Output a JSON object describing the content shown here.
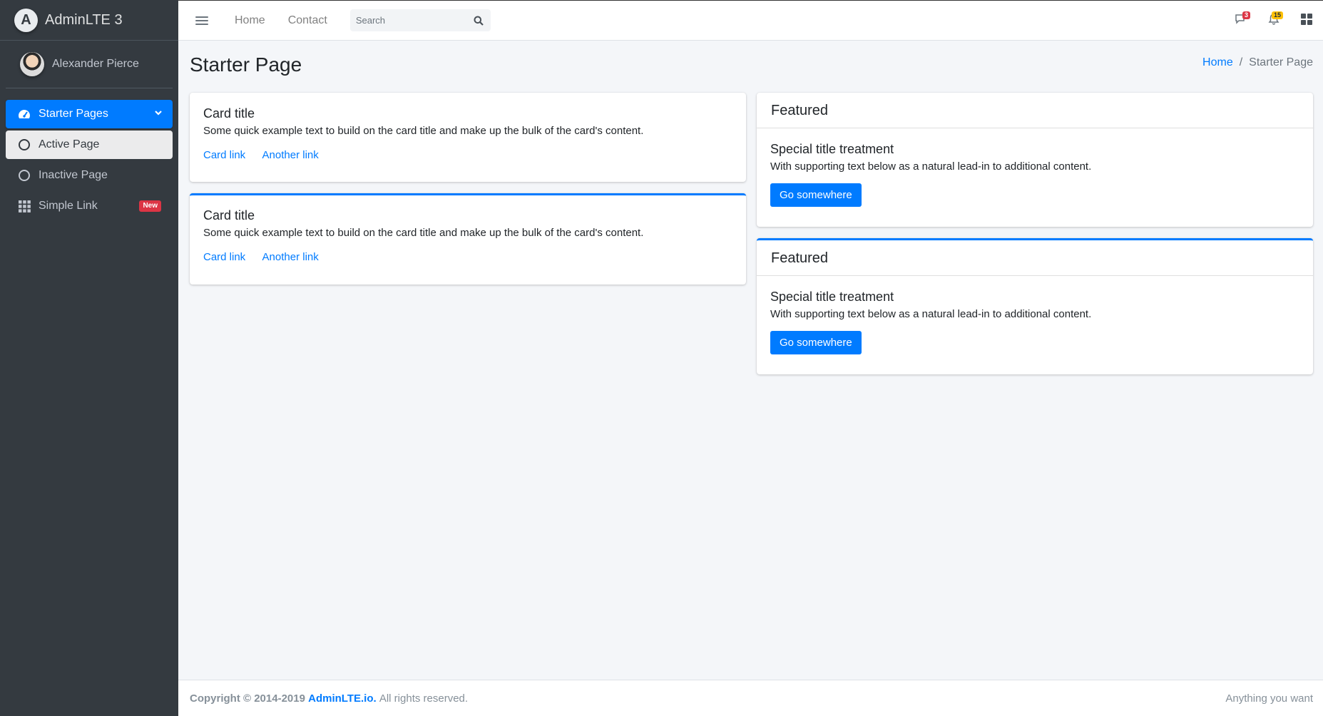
{
  "brand": {
    "name": "AdminLTE 3",
    "logo_letter": "A"
  },
  "user": {
    "name": "Alexander Pierce"
  },
  "sidebar": {
    "items": [
      {
        "label": "Starter Pages",
        "icon": "tachometer-icon",
        "state": "open"
      },
      {
        "label": "Active Page",
        "icon": "circle-icon",
        "state": "active"
      },
      {
        "label": "Inactive Page",
        "icon": "circle-icon",
        "state": "inactive"
      },
      {
        "label": "Simple Link",
        "icon": "th-icon",
        "badge": "New"
      }
    ]
  },
  "navbar": {
    "links": [
      "Home",
      "Contact"
    ],
    "search": {
      "placeholder": "Search"
    },
    "messages_count": "3",
    "notifications_count": "15"
  },
  "content_header": {
    "title": "Starter Page",
    "breadcrumb": {
      "home": "Home",
      "separator": "/",
      "current": "Starter Page"
    }
  },
  "cards_left": [
    {
      "title": "Card title",
      "text": "Some quick example text to build on the card title and make up the bulk of the card's content.",
      "link1": "Card link",
      "link2": "Another link"
    },
    {
      "title": "Card title",
      "text": "Some quick example text to build on the card title and make up the bulk of the card's content.",
      "link1": "Card link",
      "link2": "Another link"
    }
  ],
  "cards_right": [
    {
      "header": "Featured",
      "title": "Special title treatment",
      "text": "With supporting text below as a natural lead-in to additional content.",
      "button": "Go somewhere"
    },
    {
      "header": "Featured",
      "title": "Special title treatment",
      "text": "With supporting text below as a natural lead-in to additional content.",
      "button": "Go somewhere"
    }
  ],
  "footer": {
    "copyright": "Copyright © 2014-2019",
    "brand_link": "AdminLTE.io.",
    "rights": "All rights reserved.",
    "right_text": "Anything you want"
  },
  "colors": {
    "primary": "#007bff",
    "sidebar_bg": "#343a40",
    "danger": "#dc3545",
    "warning": "#ffc107"
  }
}
